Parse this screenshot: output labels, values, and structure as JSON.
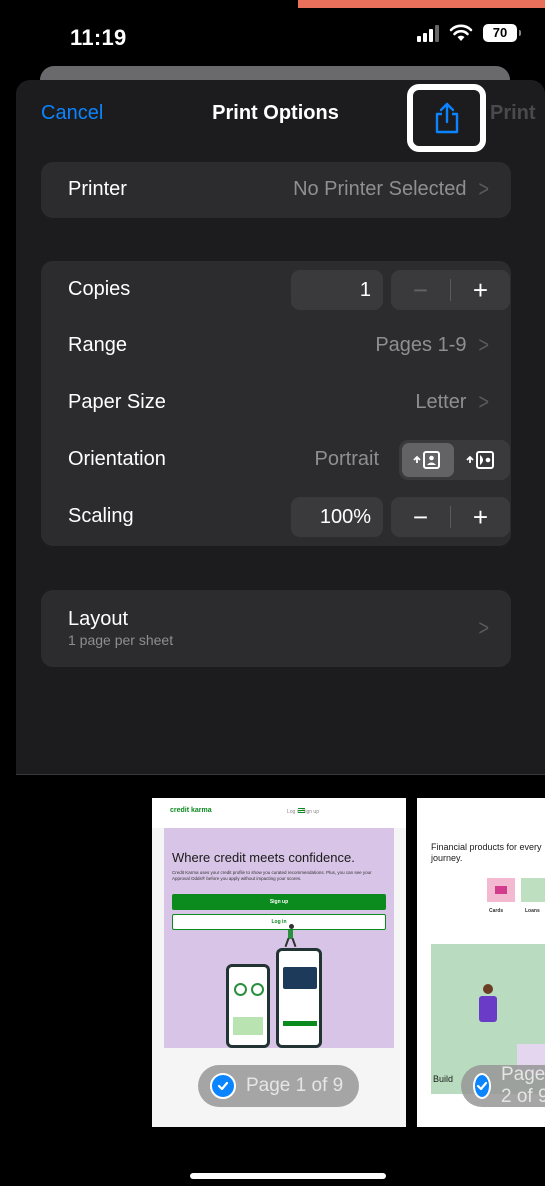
{
  "status_bar": {
    "time": "11:19",
    "battery": "70"
  },
  "nav": {
    "cancel_label": "Cancel",
    "title": "Print Options",
    "print_label": "Print"
  },
  "printer": {
    "label": "Printer",
    "value": "No Printer Selected"
  },
  "options": {
    "copies": {
      "label": "Copies",
      "value": "1",
      "minus": "−",
      "plus": "+"
    },
    "range": {
      "label": "Range",
      "value": "Pages 1-9"
    },
    "paper_size": {
      "label": "Paper Size",
      "value": "Letter"
    },
    "orientation": {
      "label": "Orientation",
      "value": "Portrait"
    },
    "scaling": {
      "label": "Scaling",
      "value": "100%",
      "minus": "−",
      "plus": "+"
    }
  },
  "layout": {
    "label": "Layout",
    "subtitle": "1 page per sheet"
  },
  "preview": {
    "page1": {
      "brand": "credit karma",
      "nav_links": "Log in   Sign up",
      "headline": "Where credit meets confidence.",
      "body": "Credit Karma uses your credit profile to show you curated recommendations. Plus, you can see your Approval Odds® before you apply without impacting your scores.",
      "signup_label": "Sign up",
      "login_label": "Log in",
      "badge": "Page 1 of 9"
    },
    "page2": {
      "headline": "Financial products for every journey.",
      "tile_cards": "Cards",
      "tile_loans": "Loans",
      "footer_text": "Build",
      "badge": "Page 2 of 9"
    }
  },
  "colors": {
    "accent_blue": "#0a84ff",
    "sheet_bg": "#1c1c1e",
    "group_bg": "#2c2c2e",
    "ck_green": "#0b8a1e",
    "ck_lilac": "#d7c4e6"
  }
}
